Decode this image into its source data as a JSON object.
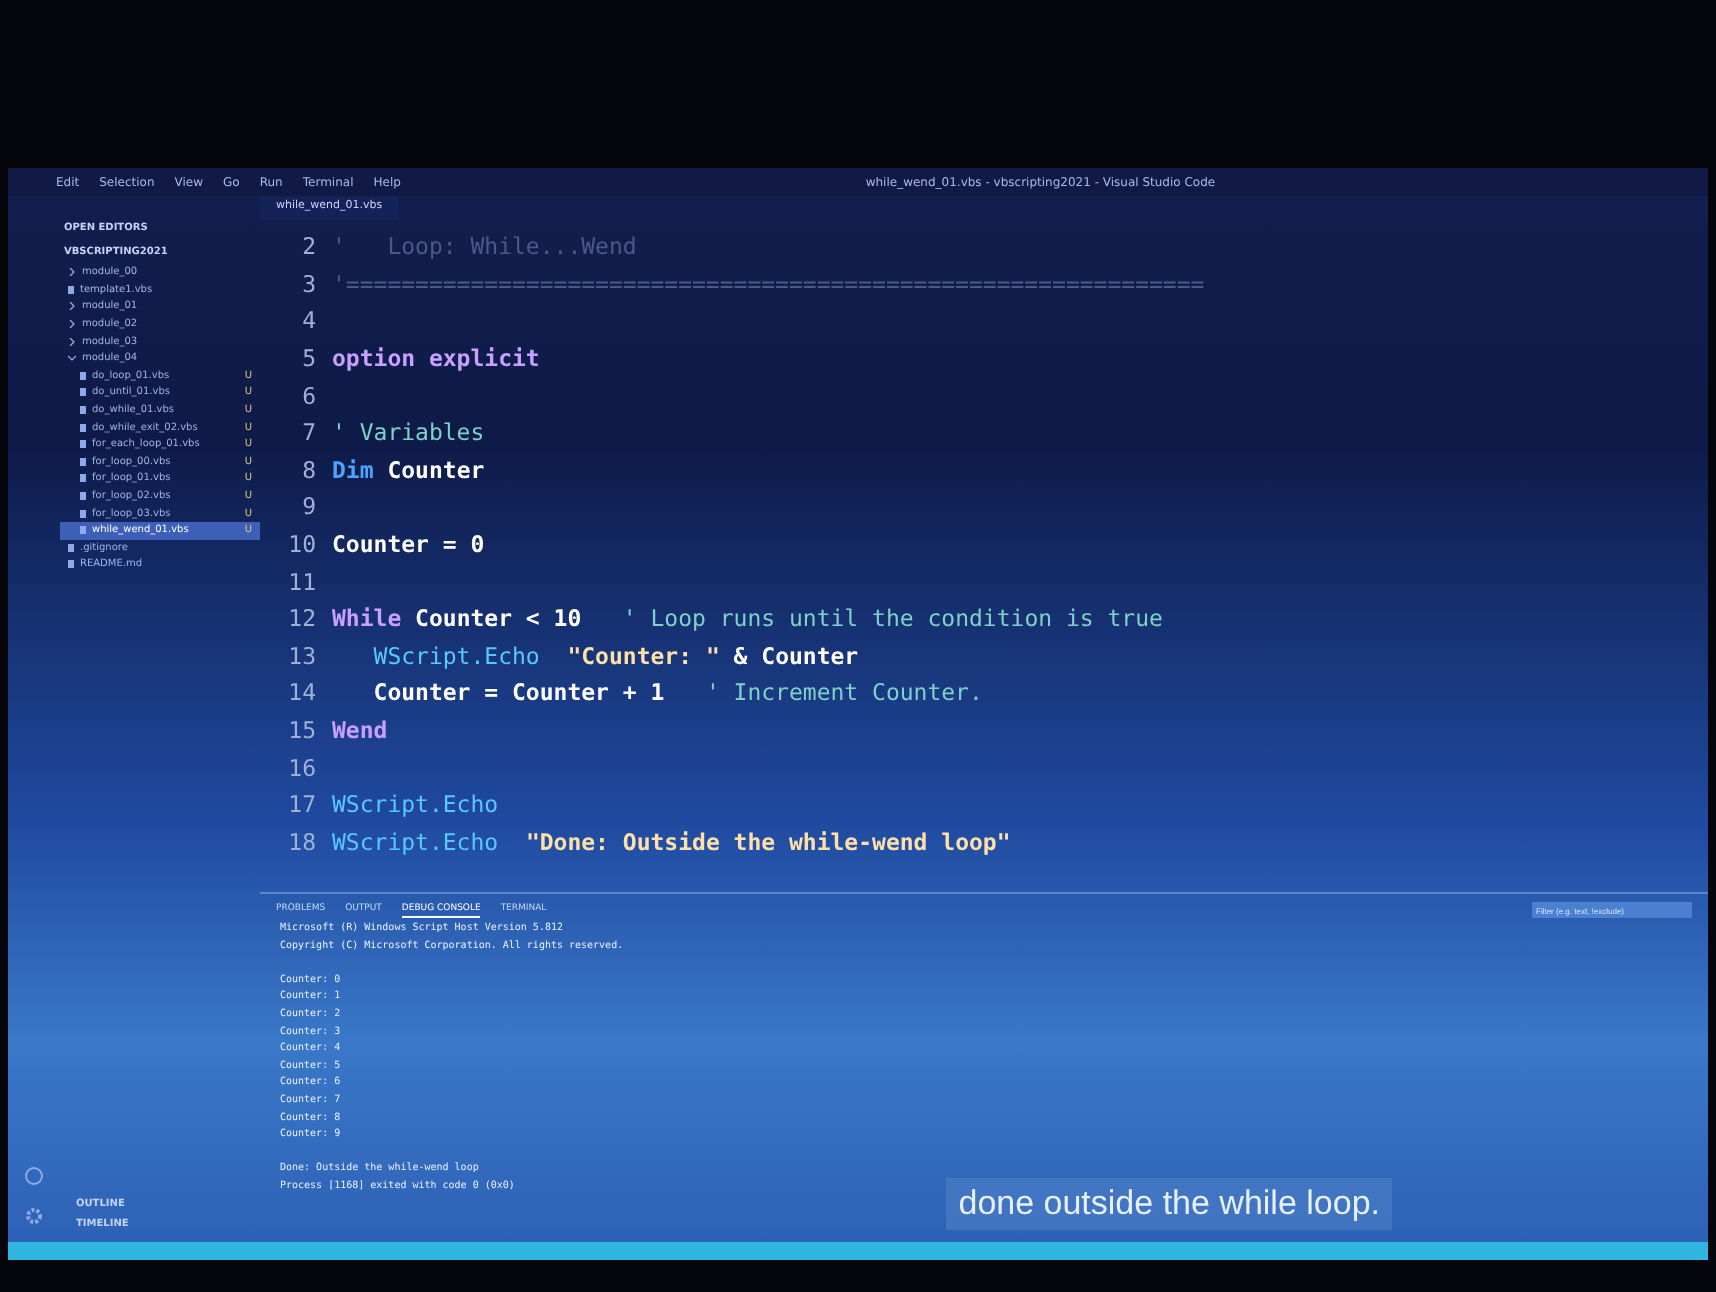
{
  "window": {
    "title": "while_wend_01.vbs - vbscripting2021 - Visual Studio Code"
  },
  "menu": [
    "Edit",
    "Selection",
    "View",
    "Go",
    "Run",
    "Terminal",
    "Help"
  ],
  "sidebar": {
    "sections": [
      "OPEN EDITORS",
      "VBSCRIPTING2021"
    ],
    "items": [
      {
        "label": "module_00",
        "kind": "folder",
        "expanded": false,
        "selected": false
      },
      {
        "label": "template1.vbs",
        "kind": "file",
        "selected": false
      },
      {
        "label": "module_01",
        "kind": "folder",
        "expanded": false,
        "selected": false
      },
      {
        "label": "module_02",
        "kind": "folder",
        "expanded": false,
        "selected": false
      },
      {
        "label": "module_03",
        "kind": "folder",
        "expanded": false,
        "selected": false
      },
      {
        "label": "module_04",
        "kind": "folder",
        "expanded": true,
        "selected": false,
        "children": [
          {
            "label": "do_loop_01.vbs",
            "kind": "file",
            "badge": "U",
            "selected": false
          },
          {
            "label": "do_until_01.vbs",
            "kind": "file",
            "badge": "U",
            "selected": false
          },
          {
            "label": "do_while_01.vbs",
            "kind": "file",
            "badge": "U",
            "selected": false
          },
          {
            "label": "do_while_exit_02.vbs",
            "kind": "file",
            "badge": "U",
            "selected": false
          },
          {
            "label": "for_each_loop_01.vbs",
            "kind": "file",
            "badge": "U",
            "selected": false
          },
          {
            "label": "for_loop_00.vbs",
            "kind": "file",
            "badge": "U",
            "selected": false
          },
          {
            "label": "for_loop_01.vbs",
            "kind": "file",
            "badge": "U",
            "selected": false
          },
          {
            "label": "for_loop_02.vbs",
            "kind": "file",
            "badge": "U",
            "selected": false
          },
          {
            "label": "for_loop_03.vbs",
            "kind": "file",
            "badge": "U",
            "selected": false
          },
          {
            "label": "while_wend_01.vbs",
            "kind": "file",
            "badge": "U",
            "selected": true
          }
        ]
      },
      {
        "label": ".gitignore",
        "kind": "file",
        "selected": false
      },
      {
        "label": "README.md",
        "kind": "file",
        "selected": false
      }
    ],
    "footer": [
      "OUTLINE",
      "TIMELINE"
    ]
  },
  "editor": {
    "tab": "while_wend_01.vbs",
    "lines": [
      {
        "number": "2",
        "tokens": [
          {
            "kind": "faded",
            "text": "'   Loop: While...Wend"
          }
        ]
      },
      {
        "number": "3",
        "tokens": [
          {
            "kind": "faded",
            "text": "'=============================================================="
          }
        ]
      },
      {
        "number": "4"
      },
      {
        "number": "5",
        "tokens": [
          {
            "kind": "keyword",
            "text": "option explicit"
          }
        ]
      },
      {
        "number": "6"
      },
      {
        "number": "7",
        "tokens": [
          {
            "kind": "comment",
            "text": "' Variables"
          }
        ]
      },
      {
        "number": "8",
        "tokens": [
          {
            "kind": "decl",
            "text": "Dim "
          },
          {
            "kind": "plain",
            "text": "Counter"
          }
        ]
      },
      {
        "number": "9"
      },
      {
        "number": "10",
        "tokens": [
          {
            "kind": "plain",
            "text": "Counter = 0"
          }
        ]
      },
      {
        "number": "11"
      },
      {
        "number": "12",
        "tokens": [
          {
            "kind": "keyword",
            "text": "While "
          },
          {
            "kind": "plain",
            "text": "Counter < 10   "
          },
          {
            "kind": "comment",
            "text": "' Loop runs until the condition is true"
          }
        ]
      },
      {
        "number": "13",
        "tokens": [
          {
            "kind": "call",
            "text": "   WScript.Echo  "
          },
          {
            "kind": "string",
            "text": "\"Counter: \""
          },
          {
            "kind": "plain",
            "text": " & Counter"
          }
        ]
      },
      {
        "number": "14",
        "tokens": [
          {
            "kind": "plain",
            "text": "   Counter = Counter + 1   "
          },
          {
            "kind": "comment",
            "text": "' Increment Counter."
          }
        ]
      },
      {
        "number": "15",
        "tokens": [
          {
            "kind": "keyword",
            "text": "Wend"
          }
        ]
      },
      {
        "number": "16"
      },
      {
        "number": "17",
        "tokens": [
          {
            "kind": "call",
            "text": "WScript.Echo"
          }
        ]
      },
      {
        "number": "18",
        "tokens": [
          {
            "kind": "call",
            "text": "WScript.Echo  "
          },
          {
            "kind": "string",
            "text": "\"Done: Outside the while-wend loop\""
          }
        ]
      }
    ]
  },
  "panel": {
    "tabs": [
      {
        "label": "PROBLEMS",
        "selected": false
      },
      {
        "label": "OUTPUT",
        "selected": false
      },
      {
        "label": "DEBUG CONSOLE",
        "selected": true
      },
      {
        "label": "TERMINAL",
        "selected": false
      }
    ],
    "filter": {
      "placeholder": "Filter (e.g. text, !exclude)"
    },
    "blocks": [
      [
        "Microsoft (R) Windows Script Host Version 5.812",
        "Copyright (C) Microsoft Corporation. All rights reserved."
      ],
      [
        "Counter: 0",
        "Counter: 1",
        "Counter: 2",
        "Counter: 3",
        "Counter: 4",
        "Counter: 5",
        "Counter: 6",
        "Counter: 7",
        "Counter: 8",
        "Counter: 9"
      ],
      [
        "Done: Outside the while-wend loop",
        "Process [1168] exited with code 0 (0x0)"
      ]
    ]
  },
  "caption": "done outside the while loop."
}
